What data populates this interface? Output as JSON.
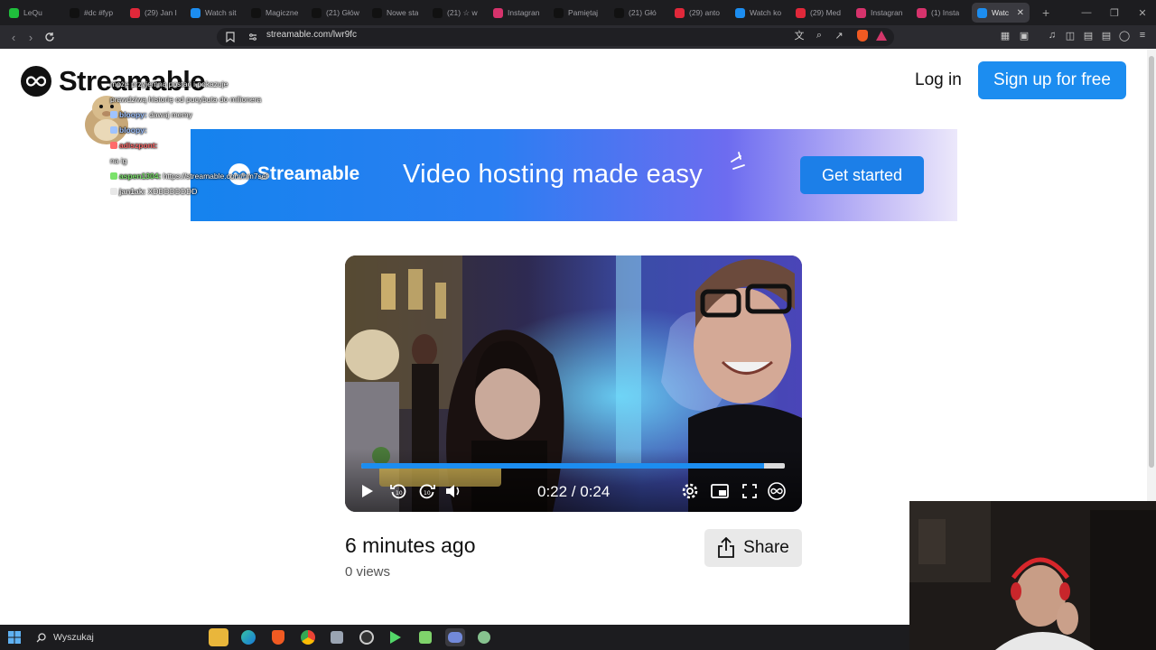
{
  "browser": {
    "tabs": [
      {
        "label": "LeQu",
        "icon": "lequipe-favicon-icon",
        "color": "#1fbf3c"
      },
      {
        "label": "#dc #fyp",
        "icon": "tiktok-icon",
        "color": "#111111"
      },
      {
        "label": "(29) Jan I",
        "icon": "youtube-icon",
        "color": "#e0283a"
      },
      {
        "label": "Watch sit",
        "icon": "streamable-icon",
        "color": "#1c8df0"
      },
      {
        "label": "Magiczne",
        "icon": "tiktok-icon",
        "color": "#111111"
      },
      {
        "label": "(21) Głów",
        "icon": "x-icon",
        "color": "#111111"
      },
      {
        "label": "Nowe sta",
        "icon": "tiktok-icon",
        "color": "#111111"
      },
      {
        "label": "(21) ☆ w",
        "icon": "x-icon",
        "color": "#111111"
      },
      {
        "label": "Instagran",
        "icon": "instagram-icon",
        "color": "#d6336c"
      },
      {
        "label": "Pamiętaj",
        "icon": "tiktok-icon",
        "color": "#111111"
      },
      {
        "label": "(21) Głó",
        "icon": "x-icon",
        "color": "#111111"
      },
      {
        "label": "(29) anto",
        "icon": "youtube-icon",
        "color": "#e0283a"
      },
      {
        "label": "Watch ko",
        "icon": "streamable-icon",
        "color": "#1c8df0"
      },
      {
        "label": "(29) Med",
        "icon": "youtube-icon",
        "color": "#e0283a"
      },
      {
        "label": "Instagran",
        "icon": "instagram-icon",
        "color": "#d6336c"
      },
      {
        "label": "(1) Insta",
        "icon": "instagram-icon",
        "color": "#d6336c"
      }
    ],
    "active_tab": {
      "label": "Watc",
      "icon": "streamable-icon",
      "color": "#1c8df0"
    },
    "url": "streamable.com/lwr9fc"
  },
  "header": {
    "logo_text": "Streamable",
    "login_label": "Log in",
    "signup_label": "Sign up for free"
  },
  "banner": {
    "brand": "Streamable",
    "tagline": "Video hosting made easy",
    "cta_label": "Get started"
  },
  "video": {
    "current_time": "0:22",
    "duration": "0:24",
    "time_display": "0:22 / 0:24",
    "progress": 0.952
  },
  "meta": {
    "posted": "6 minutes ago",
    "views": "0 views",
    "share_label": "Share"
  },
  "chat": [
    {
      "user": "",
      "text": "może przyjemna postać i pokazuje",
      "color": "#ffffff"
    },
    {
      "user": "",
      "text": "prawdziwą historię od pucybuta do milionera",
      "color": "#ffffff"
    },
    {
      "user": "bloopy:",
      "text": "dawaj memy",
      "color": "#9fc3ff"
    },
    {
      "user": "bloopy:",
      "text": "",
      "color": "#9fc3ff"
    },
    {
      "user": "adiszpont:",
      "text": "",
      "color": "#ff6b6b"
    },
    {
      "user": "",
      "text": "na ig",
      "color": "#ffffff"
    },
    {
      "user": "aspen1304:",
      "text": "https://streamable.com/hm7sef",
      "color": "#7be26b"
    },
    {
      "user": "jan1ak:",
      "text": "XDDDDDDDD",
      "color": "#e8e8e8"
    }
  ],
  "taskbar": {
    "search_placeholder": "Wyszukaj",
    "apps": [
      "file-explorer-icon",
      "edge-icon",
      "brave-icon",
      "chrome-icon",
      "app-icon",
      "obs-icon",
      "app-icon",
      "app-icon",
      "discord-icon",
      "app-icon"
    ]
  },
  "colors": {
    "accent": "#1c8df0",
    "banner_start": "#1583ee",
    "banner_end": "#ece8fb"
  }
}
